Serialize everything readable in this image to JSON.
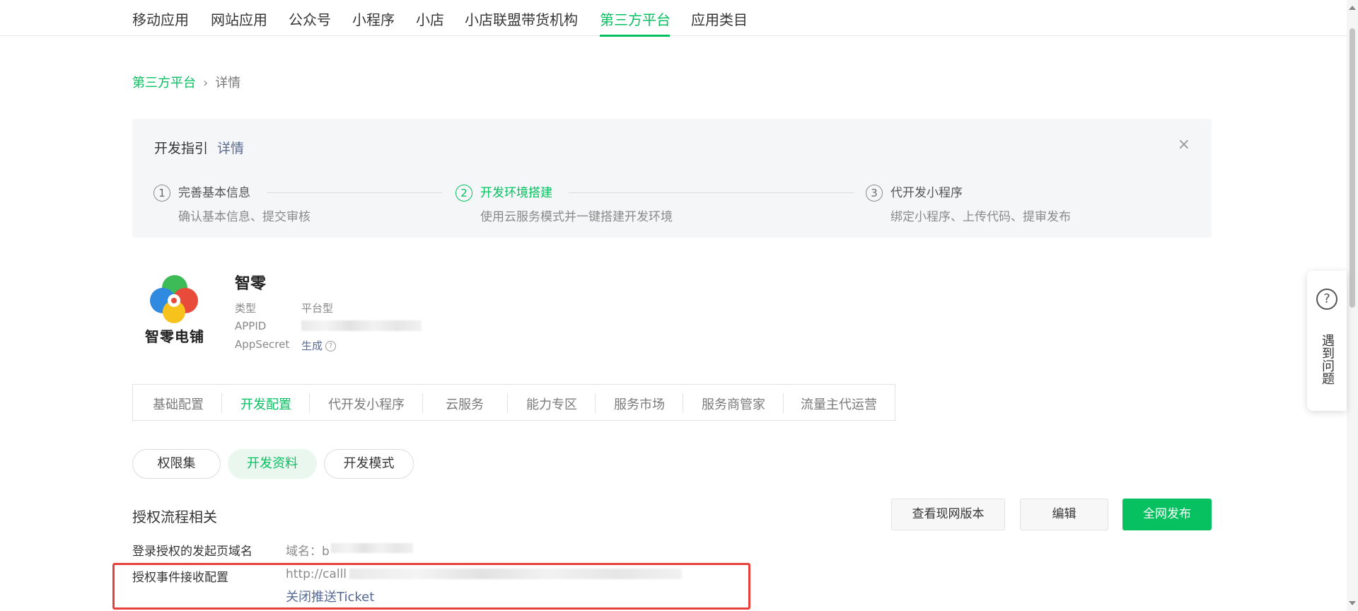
{
  "topnav": {
    "items": [
      {
        "label": "移动应用"
      },
      {
        "label": "网站应用"
      },
      {
        "label": "公众号"
      },
      {
        "label": "小程序"
      },
      {
        "label": "小店"
      },
      {
        "label": "小店联盟带货机构"
      },
      {
        "label": "第三方平台"
      },
      {
        "label": "应用类目"
      }
    ],
    "active_index": 6
  },
  "breadcrumb": {
    "parent": "第三方平台",
    "separator": "›",
    "current": "详情"
  },
  "guide": {
    "title": "开发指引",
    "detail_link": "详情",
    "close": "×",
    "steps": [
      {
        "num": "1",
        "title": "完善基本信息",
        "desc": "确认基本信息、提交审核"
      },
      {
        "num": "2",
        "title": "开发环境搭建",
        "desc": "使用云服务模式并一键搭建开发环境"
      },
      {
        "num": "3",
        "title": "代开发小程序",
        "desc": "绑定小程序、上传代码、提审发布"
      }
    ],
    "active_step": 1
  },
  "app": {
    "logo_text": "智零电铺",
    "name": "智零",
    "type_label": "类型",
    "type_value": "平台型",
    "appid_label": "APPID",
    "secret_label": "AppSecret",
    "secret_link": "生成",
    "help_icon": "?"
  },
  "tabs": {
    "items": [
      {
        "label": "基础配置"
      },
      {
        "label": "开发配置"
      },
      {
        "label": "代开发小程序"
      },
      {
        "label": "云服务"
      },
      {
        "label": "能力专区"
      },
      {
        "label": "服务市场"
      },
      {
        "label": "服务商管家"
      },
      {
        "label": "流量主代运营"
      }
    ],
    "active_index": 1
  },
  "pills": {
    "items": [
      {
        "label": "权限集"
      },
      {
        "label": "开发资料"
      },
      {
        "label": "开发模式"
      }
    ],
    "active_index": 1
  },
  "section": {
    "title": "授权流程相关",
    "buttons": {
      "view_live": "查看现网版本",
      "edit": "编辑",
      "publish": "全网发布"
    },
    "rows": {
      "domain_label": "登录授权的发起页域名",
      "domain_value": "域名：b",
      "event_label": "授权事件接收配置",
      "event_value": "http://calll",
      "event_link": "关闭推送Ticket"
    }
  },
  "float_help": {
    "icon": "?",
    "text": "遇到问题"
  },
  "colors": {
    "accent": "#07c160",
    "link": "#576b95",
    "highlight": "#e8403a"
  }
}
